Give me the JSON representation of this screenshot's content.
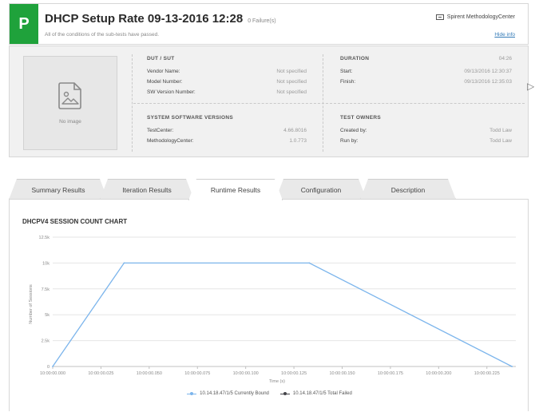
{
  "header": {
    "badge": "P",
    "title": "DHCP Setup Rate 09-13-2016 12:28",
    "failures": "0 Failure(s)",
    "subtitle": "All of the conditions of the sub-tests have passed.",
    "vendor": "Spirent MethodologyCenter",
    "hide_info": "Hide info",
    "badge_color": "#1fa23b"
  },
  "info": {
    "no_image": "No image",
    "dut": {
      "title": "DUT / SUT",
      "rows": [
        {
          "k": "Vendor Name:",
          "v": "Not specified"
        },
        {
          "k": "Model Number:",
          "v": "Not specified"
        },
        {
          "k": "SW Version Number:",
          "v": "Not specified"
        }
      ]
    },
    "duration": {
      "title": "DURATION",
      "value": "04:26",
      "rows": [
        {
          "k": "Start:",
          "v": "09/13/2016 12:30:37"
        },
        {
          "k": "Finish:",
          "v": "09/13/2016 12:35:03"
        }
      ]
    },
    "versions": {
      "title": "SYSTEM SOFTWARE VERSIONS",
      "rows": [
        {
          "k": "TestCenter:",
          "v": "4.66.8016"
        },
        {
          "k": "MethodologyCenter:",
          "v": "1.0.773"
        }
      ]
    },
    "owners": {
      "title": "TEST OWNERS",
      "rows": [
        {
          "k": "Created by:",
          "v": "Todd Law"
        },
        {
          "k": "Run by:",
          "v": "Todd Law"
        }
      ]
    }
  },
  "tabs": [
    {
      "label": "Summary Results",
      "active": false
    },
    {
      "label": "Iteration Results",
      "active": false
    },
    {
      "label": "Runtime Results",
      "active": true
    },
    {
      "label": "Configuration",
      "active": false
    },
    {
      "label": "Description",
      "active": false
    }
  ],
  "chart_data": {
    "type": "line",
    "title": "DHCPV4 SESSION COUNT CHART",
    "xlabel": "Time (s)",
    "ylabel": "Number of Sessions",
    "ylim": [
      0,
      12500
    ],
    "yticks": [
      {
        "value": 0,
        "label": "0"
      },
      {
        "value": 2500,
        "label": "2.5k"
      },
      {
        "value": 5000,
        "label": "5k"
      },
      {
        "value": 7500,
        "label": "7.5k"
      },
      {
        "value": 10000,
        "label": "10k"
      },
      {
        "value": 12500,
        "label": "12.5k"
      }
    ],
    "xlim": [
      0,
      0.24
    ],
    "xticks": [
      {
        "value": 0,
        "label": "10:00:00.000"
      },
      {
        "value": 0.025,
        "label": "10:00:00.025"
      },
      {
        "value": 0.05,
        "label": "10:00:00.050"
      },
      {
        "value": 0.075,
        "label": "10:00:00.075"
      },
      {
        "value": 0.1,
        "label": "10:00:00.100"
      },
      {
        "value": 0.125,
        "label": "10:00:00.125"
      },
      {
        "value": 0.15,
        "label": "10:00:00.150"
      },
      {
        "value": 0.175,
        "label": "10:00:00.175"
      },
      {
        "value": 0.2,
        "label": "10:00:00.200"
      },
      {
        "value": 0.225,
        "label": "10:00:00.225"
      }
    ],
    "grid": true,
    "legend_position": "bottom",
    "series": [
      {
        "name": "10.14.18.47/1/5 Currently Bound",
        "color": "#7cb5ec",
        "points": [
          [
            0.0,
            0
          ],
          [
            0.037,
            10000
          ],
          [
            0.133,
            10000
          ],
          [
            0.238,
            0
          ]
        ]
      },
      {
        "name": "10.14.18.47/1/5 Total Failed",
        "color": "#434348",
        "points": []
      }
    ]
  }
}
